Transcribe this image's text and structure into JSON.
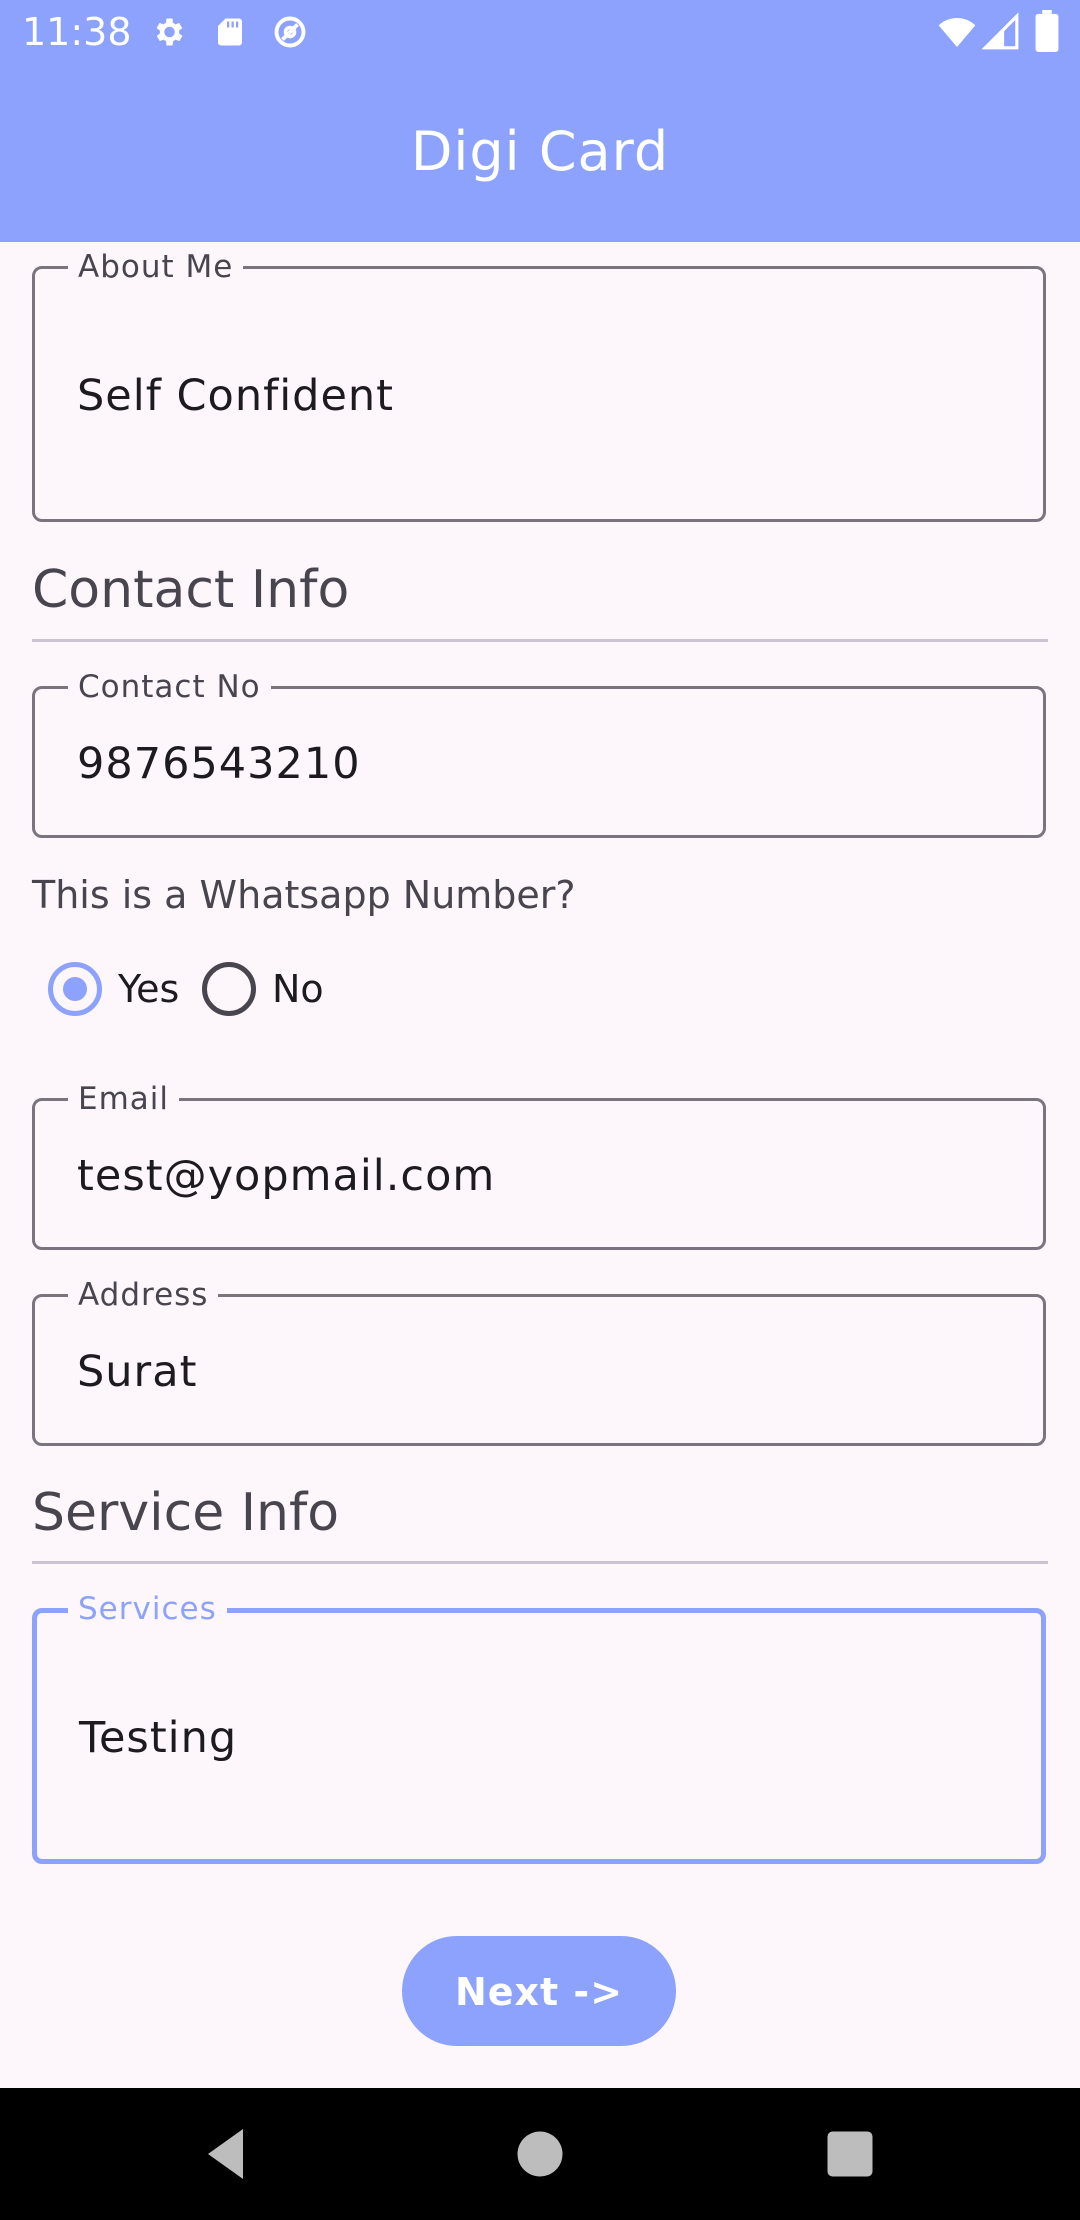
{
  "status_bar": {
    "time": "11:38",
    "left_icons": [
      "gear-icon",
      "sd-card-icon",
      "at-sign-icon"
    ],
    "right_icons": [
      "wifi-icon",
      "signal-icon",
      "battery-icon"
    ]
  },
  "app_bar": {
    "title": "Digi Card"
  },
  "about": {
    "label": "About Me",
    "value": "Self Confident"
  },
  "contact_section": {
    "title": "Contact Info"
  },
  "contact_no": {
    "label": "Contact No",
    "value": "9876543210"
  },
  "whatsapp": {
    "question": "This is a Whatsapp Number?",
    "options": [
      {
        "label": "Yes",
        "selected": true
      },
      {
        "label": "No",
        "selected": false
      }
    ]
  },
  "email": {
    "label": "Email",
    "value": "test@yopmail.com"
  },
  "address": {
    "label": "Address",
    "value": "Surat"
  },
  "service_section": {
    "title": "Service Info"
  },
  "services": {
    "label": "Services",
    "value": "Testing",
    "focused": true
  },
  "next_button": {
    "label": "Next  ->"
  },
  "nav_bar": {
    "icons": [
      "back-icon",
      "home-icon",
      "recents-icon"
    ]
  },
  "colors": {
    "accent": "#8ca2fc",
    "background": "#fdf7fc",
    "outline": "#79747e",
    "nav_background": "#000000"
  }
}
